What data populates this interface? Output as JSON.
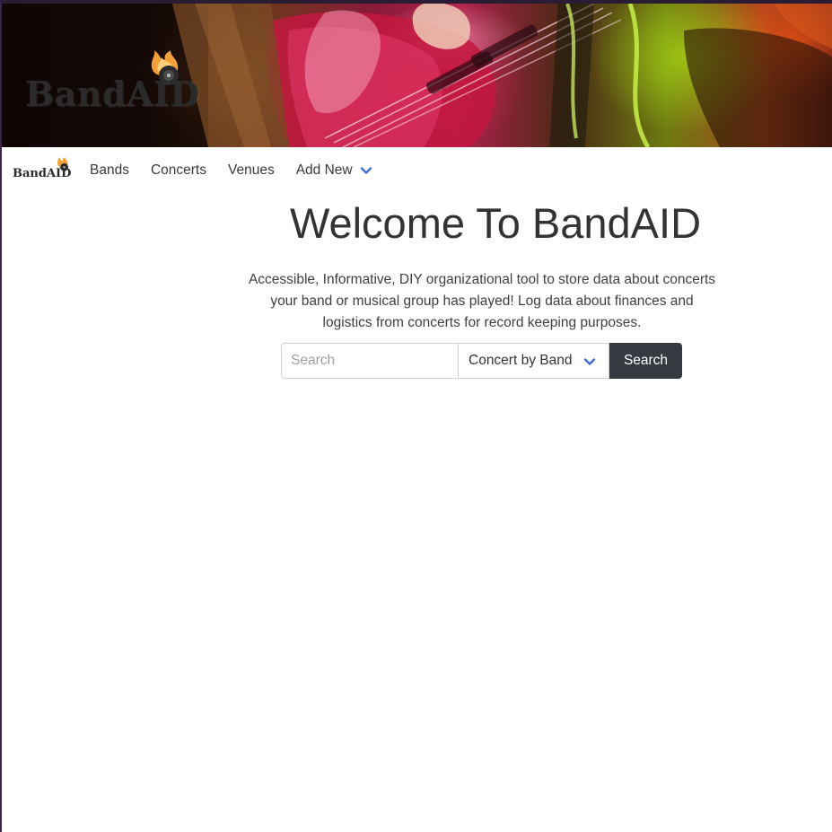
{
  "banner": {
    "brand_wordmark": "BandAID",
    "image_description_icon": "guitar-photo"
  },
  "navbar": {
    "logo_wordmark": "BandAID",
    "links": [
      {
        "label": "Bands"
      },
      {
        "label": "Concerts"
      },
      {
        "label": "Venues"
      },
      {
        "label": "Add New",
        "has_dropdown": true
      }
    ],
    "caret_icon": "chevron-down-icon",
    "accent_color": "#3b6fd4"
  },
  "main": {
    "title": "Welcome To BandAID",
    "description": "Accessible, Informative, DIY organizational tool to store data about concerts your band or musical group has played! Log data about finances and logistics from concerts for record keeping purposes."
  },
  "search": {
    "placeholder": "Search",
    "value": "",
    "filter_selected": "Concert by Band",
    "button_label": "Search",
    "button_color": "#343a40"
  },
  "colors": {
    "flame_orange": "#f2a03a",
    "text_dark": "#333333"
  }
}
